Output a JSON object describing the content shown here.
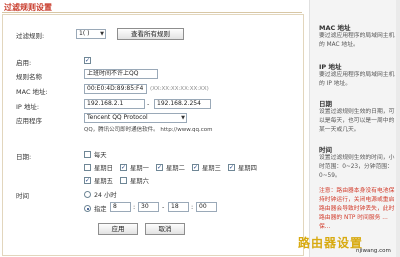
{
  "page": {
    "title": "过滤规则设置"
  },
  "form": {
    "rule_label": "过滤规则:",
    "rule_value": "1(  )",
    "view_all_button": "查看所有规则",
    "enable_label": "启用:",
    "enabled": true,
    "name_label": "规则名称",
    "name_value": "上班时间不许上QQ",
    "mac_label": "MAC 地址:",
    "mac_value": "00:E0:4D:89:85:F4",
    "mac_hint": "(XX:XX:XX:XX:XX:XX)",
    "ip_label": "IP 地址:",
    "ip_start": "192.168.2.1",
    "ip_separator": "-",
    "ip_end": "192.168.2.254",
    "app_label": "应用程序",
    "app_value": "Tencent QQ Protocol",
    "app_desc": "QQ，腾讯公司即时通信软件。 http://www.qq.com",
    "date_label": "日期:",
    "everyday_label": "每天",
    "days": [
      {
        "label": "星期日",
        "checked": false
      },
      {
        "label": "星期一",
        "checked": true
      },
      {
        "label": "星期二",
        "checked": true
      },
      {
        "label": "星期三",
        "checked": true
      },
      {
        "label": "星期四",
        "checked": true
      },
      {
        "label": "星期五",
        "checked": true
      },
      {
        "label": "星期六",
        "checked": false
      }
    ],
    "time_label": "时间",
    "time_24h_label": "24 小时",
    "time_specify_label": "指定",
    "time_from_h": "8",
    "time_from_m": "30",
    "time_to_h": "18",
    "time_to_m": "00",
    "time_dash": "-",
    "time_colon": ":",
    "apply_button": "应用",
    "cancel_button": "取消"
  },
  "help": {
    "mac_title": "MAC 地址",
    "mac_text": "要过滤应用程序的局域网主机的 MAC 地址。",
    "ip_title": "IP 地址",
    "ip_text": "要过滤应用程序的局域网主机的 IP 地址。",
    "date_title": "日期",
    "date_text": "设置过滤规则生效的日期，可以是每天，也可以是一周中的某一天或几天。",
    "time_title": "时间",
    "time_text": "设置过滤规则生效的时间，小时范围：0~23，分钟范围：0~59。",
    "note_text": "注意：路由器本身没有电池保持时钟运行，关闭电源或重启路由器会导致时钟丢失，此时路由器的 NTP 时间服务 ... 保..."
  },
  "watermark": {
    "brand": "路由器设置",
    "site": "njiwang.com"
  }
}
